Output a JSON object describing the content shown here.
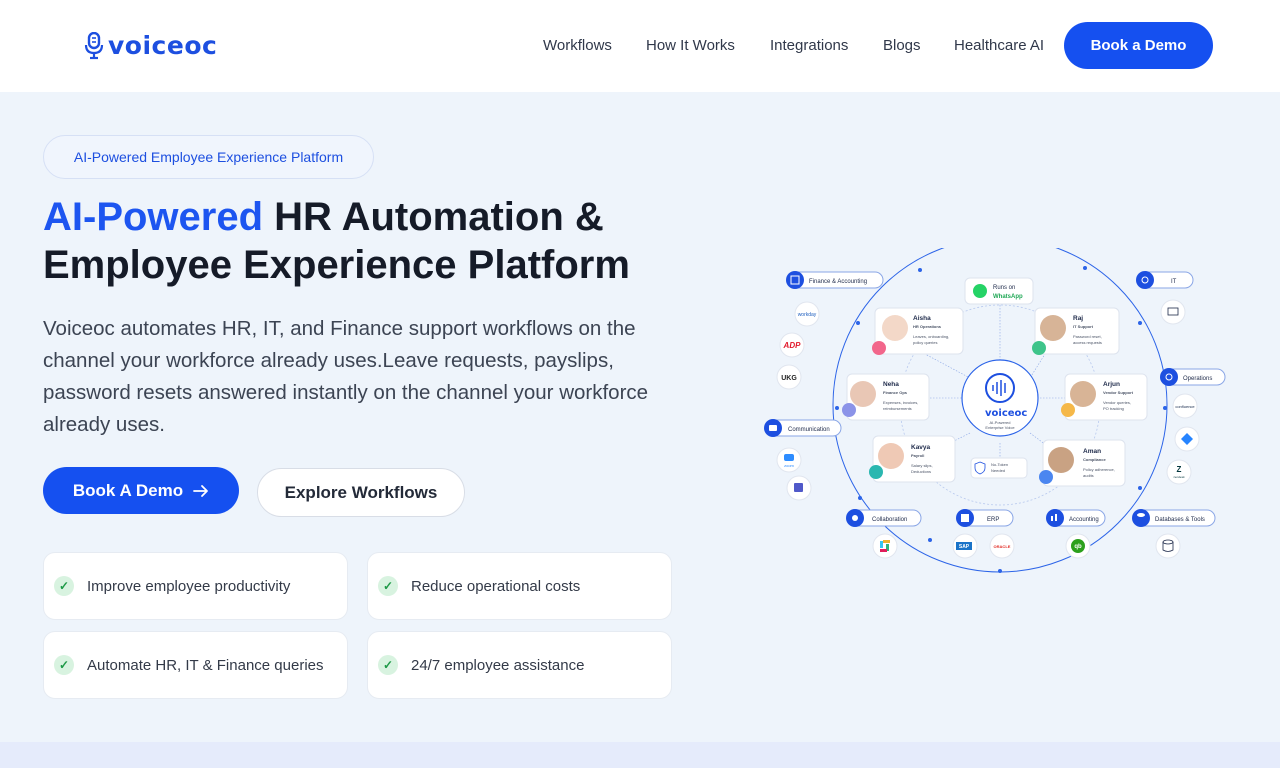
{
  "brand": {
    "name": "voiceoc",
    "color": "#1d4fe0"
  },
  "nav": {
    "items": [
      "Workflows",
      "How It Works",
      "Integrations",
      "Blogs",
      "Healthcare AI"
    ],
    "cta": "Book a Demo"
  },
  "hero": {
    "badge": "AI-Powered Employee Experience Platform",
    "headline_accent": "AI-Powered",
    "headline_rest": " HR Automation & Employee Experience Platform",
    "description": "Voiceoc automates HR, IT, and Finance support workflows on the channel your workforce already uses.Leave requests, payslips, password resets answered instantly on the channel your workforce already uses.",
    "primary_button": "Book A Demo",
    "secondary_button": "Explore Workflows",
    "features": [
      "Improve employee productivity",
      "Reduce operational costs",
      "Automate HR, IT & Finance queries",
      "24/7 employee assistance"
    ]
  },
  "diagram": {
    "hub": {
      "brand": "voiceoc",
      "caption_line1": "AI-Powered",
      "caption_line2": "Enterprise Voice"
    },
    "whatsapp": {
      "line1": "Runs on",
      "line2": "WhatsApp"
    },
    "no_token": {
      "line1": "No-Token",
      "line2": "Needed"
    },
    "categories": {
      "finance": "Finance & Accounting",
      "it": "IT",
      "operations": "Operations",
      "communication": "Communication",
      "collaboration": "Collaboration",
      "erp": "ERP",
      "accounting": "Accounting",
      "databases": "Databases & Tools"
    },
    "logos": {
      "workday": "workday",
      "adp": "ADP",
      "ukg": "UKG",
      "zoom": "zoom",
      "confluence": "confluence",
      "zendesk": "zendesk",
      "sap": "SAP",
      "oracle": "ORACLE",
      "quickbooks": "qb"
    },
    "agents": [
      {
        "name": "Aisha",
        "role": "HR Operations",
        "detail1": "Leaves, onboarding,",
        "detail2": "policy queries"
      },
      {
        "name": "Raj",
        "role": "IT Support",
        "detail1": "Password reset,",
        "detail2": "access requests"
      },
      {
        "name": "Neha",
        "role": "Finance Ops",
        "detail1": "Expenses, invoices,",
        "detail2": "reimbursements"
      },
      {
        "name": "Arjun",
        "role": "Vendor Support",
        "detail1": "Vendor queries,",
        "detail2": "PO tracking"
      },
      {
        "name": "Kavya",
        "role": "Payroll",
        "detail1": "Salary slips,",
        "detail2": "Deductions"
      },
      {
        "name": "Aman",
        "role": "Compliance",
        "detail1": "Policy adherence,",
        "detail2": "audits"
      }
    ]
  }
}
